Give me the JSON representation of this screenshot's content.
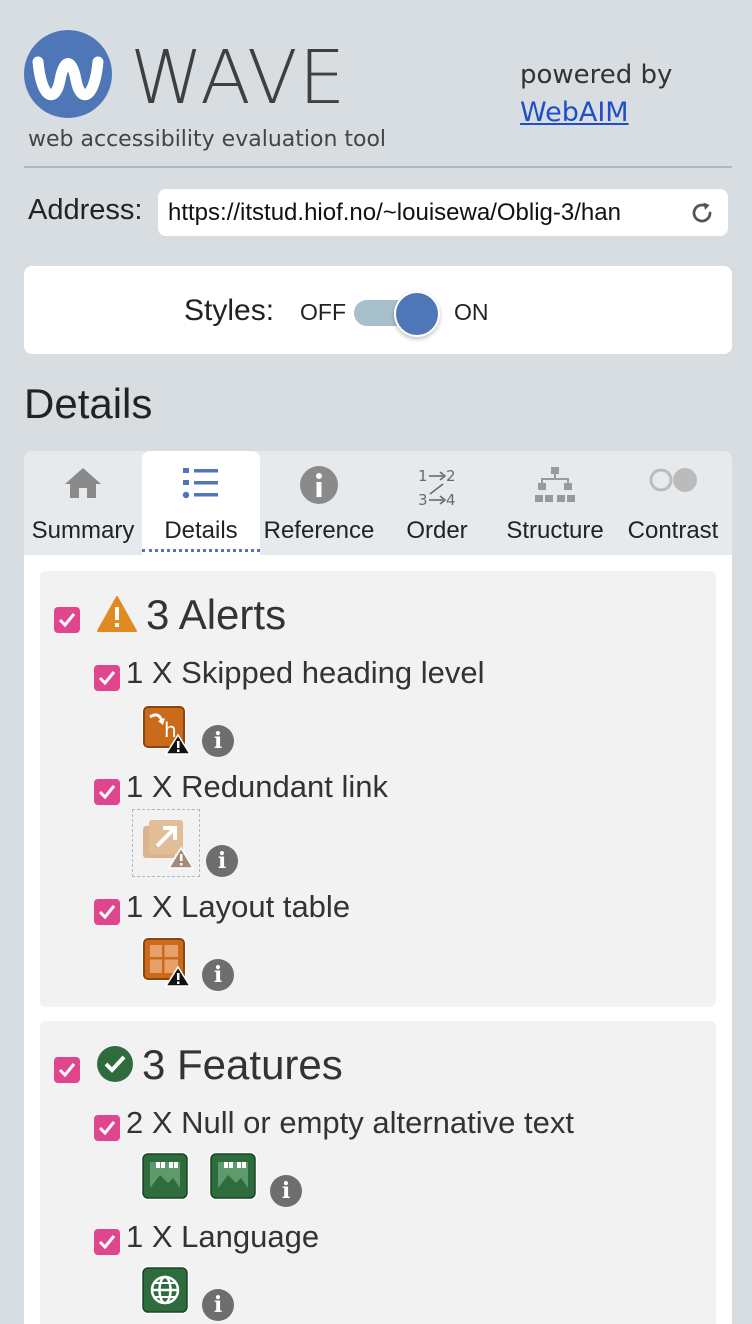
{
  "header": {
    "logo_word": "WAVE",
    "tagline": "web accessibility evaluation tool",
    "powered_by": "powered by",
    "webaim_link": "WebAIM"
  },
  "address": {
    "label": "Address:",
    "value": "https://itstud.hiof.no/~louisewa/Oblig-3/han"
  },
  "styles": {
    "label": "Styles:",
    "off": "OFF",
    "on": "ON",
    "state": "on"
  },
  "section_title": "Details",
  "tabs": [
    {
      "label": "Summary",
      "icon": "home-icon"
    },
    {
      "label": "Details",
      "icon": "list-icon",
      "active": true
    },
    {
      "label": "Reference",
      "icon": "info-icon"
    },
    {
      "label": "Order",
      "icon": "order-icon"
    },
    {
      "label": "Structure",
      "icon": "structure-icon"
    },
    {
      "label": "Contrast",
      "icon": "contrast-icon"
    }
  ],
  "order_icon_text": {
    "a": "1",
    "b": "2",
    "c": "3",
    "d": "4"
  },
  "alerts": {
    "title": "3 Alerts",
    "items": [
      {
        "label": "1 X Skipped heading level",
        "icon": "skipped-heading-icon"
      },
      {
        "label": "1 X Redundant link",
        "icon": "redundant-link-icon"
      },
      {
        "label": "1 X Layout table",
        "icon": "layout-table-icon"
      }
    ]
  },
  "features": {
    "title": "3 Features",
    "items": [
      {
        "label": "2 X Null or empty alternative text",
        "icon": "null-alt-icon"
      },
      {
        "label": "1 X Language",
        "icon": "language-icon"
      }
    ]
  },
  "badge_glyph": "h",
  "info_glyph": "i",
  "colors": {
    "accent": "#4f77b8",
    "checkbox": "#e0468e",
    "alert": "#c96b1a",
    "feature": "#2e6b3d"
  }
}
